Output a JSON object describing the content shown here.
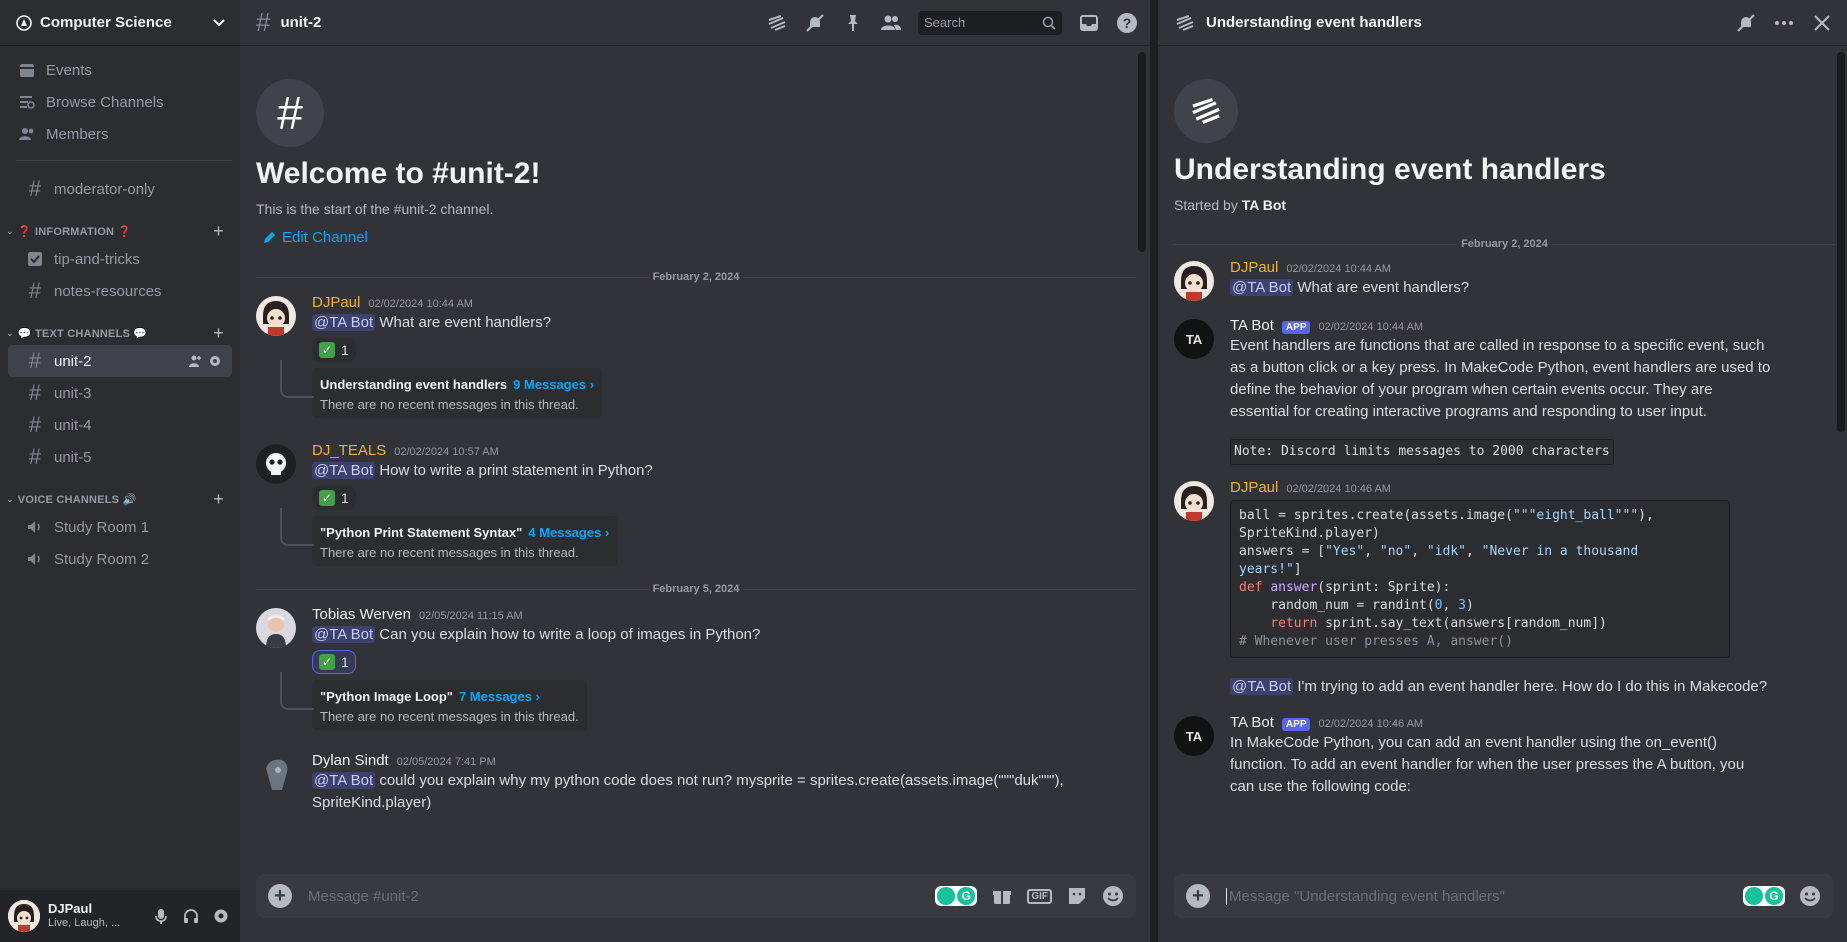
{
  "sidebar": {
    "server_name": "Computer Science",
    "top_items": [
      {
        "label": "Events",
        "icon": "calendar-icon"
      },
      {
        "label": "Browse Channels",
        "icon": "browse-channels-icon"
      },
      {
        "label": "Members",
        "icon": "members-icon"
      }
    ],
    "standalone_channels": [
      {
        "label": "moderator-only"
      }
    ],
    "categories": [
      {
        "label": "❓ INFORMATION ❓",
        "channels": [
          "tip-and-tricks",
          "notes-resources"
        ]
      },
      {
        "label": "💬 TEXT CHANNELS 💬",
        "channels": [
          "unit-2",
          "unit-3",
          "unit-4",
          "unit-5"
        ]
      },
      {
        "label": "VOICE CHANNELS 🔊",
        "channels": [
          "Study Room 1",
          "Study Room 2"
        ]
      }
    ],
    "active_channel": "unit-2",
    "user": {
      "name": "DJPaul",
      "status": "Live, Laugh, ..."
    }
  },
  "main": {
    "channel_name": "unit-2",
    "search_placeholder": "Search",
    "welcome_title": "Welcome to #unit-2!",
    "welcome_sub": "This is the start of the #unit-2 channel.",
    "edit_channel": "Edit Channel",
    "date_1": "February 2, 2024",
    "date_2": "February 5, 2024",
    "messages": [
      {
        "author": "DJPaul",
        "time": "02/02/2024 10:44 AM",
        "mention": "@TA Bot",
        "text": "What are event handlers?",
        "reaction_count": "1",
        "thread_title": "Understanding event handlers",
        "thread_count": "9 Messages ›",
        "thread_sub": "There are no recent messages in this thread."
      },
      {
        "author": "DJ_TEALS",
        "time": "02/02/2024 10:57 AM",
        "mention": "@TA Bot",
        "text": "How to write a print statement in  Python?",
        "reaction_count": "1",
        "thread_title": "\"Python Print Statement Syntax\"",
        "thread_count": "4 Messages ›",
        "thread_sub": "There are no recent messages in this thread."
      },
      {
        "author": "Tobias Werven",
        "time": "02/05/2024 11:15 AM",
        "mention": "@TA Bot",
        "text": " Can you explain how to write a loop of images in Python?",
        "reaction_count": "1",
        "thread_title": "\"Python Image Loop\"",
        "thread_count": "7 Messages ›",
        "thread_sub": "There are no recent messages in this thread."
      },
      {
        "author": "Dylan Sindt",
        "time": "02/05/2024 7:41 PM",
        "mention": "@TA Bot",
        "text": "could you explain why my python code does not run? mysprite = sprites.create(assets.image(\"\"\"duk\"\"\"),",
        "text2": "SpriteKind.player)"
      }
    ],
    "composer_placeholder": "Message #unit-2"
  },
  "thread": {
    "title": "Understanding event handlers",
    "started_by_prefix": "Started by",
    "started_by": "TA Bot",
    "date": "February 2, 2024",
    "app_tag": "APP",
    "ta_avatar_text": "TA",
    "msg1": {
      "author": "DJPaul",
      "time": "02/02/2024 10:44 AM",
      "mention": "@TA Bot",
      "text": "What are event handlers?"
    },
    "msg2": {
      "author": "TA Bot",
      "time": "02/02/2024 10:44 AM",
      "lines": [
        "Event handlers are functions that are called in response to a specific event, such",
        "as a button click or a key press. In MakeCode Python, event handlers are used to",
        "define the behavior of your program when certain events occur. They are",
        "essential for creating interactive programs and responding to user input."
      ],
      "note": "Note: Discord limits messages to 2000 characters"
    },
    "msg3": {
      "author": "DJPaul",
      "time": "02/02/2024 10:46 AM",
      "followup_mention": "@TA Bot",
      "followup_text": "I'm trying to add an event handler here. How do I do this in Makecode?"
    },
    "msg4": {
      "author": "TA Bot",
      "time": "02/02/2024 10:46 AM",
      "lines": [
        "In MakeCode Python, you can add an event handler using the on_event()",
        "function. To add an event handler for when the user presses the A button, you",
        "can use the following code:"
      ]
    },
    "composer_placeholder": "Message \"Understanding event handlers\""
  },
  "colors": {
    "djpaul": "#f0b232",
    "dj_teals": "#f0b232",
    "default_name": "#f2f3f5",
    "link": "#00a8fc",
    "accent": "#5865f2"
  }
}
